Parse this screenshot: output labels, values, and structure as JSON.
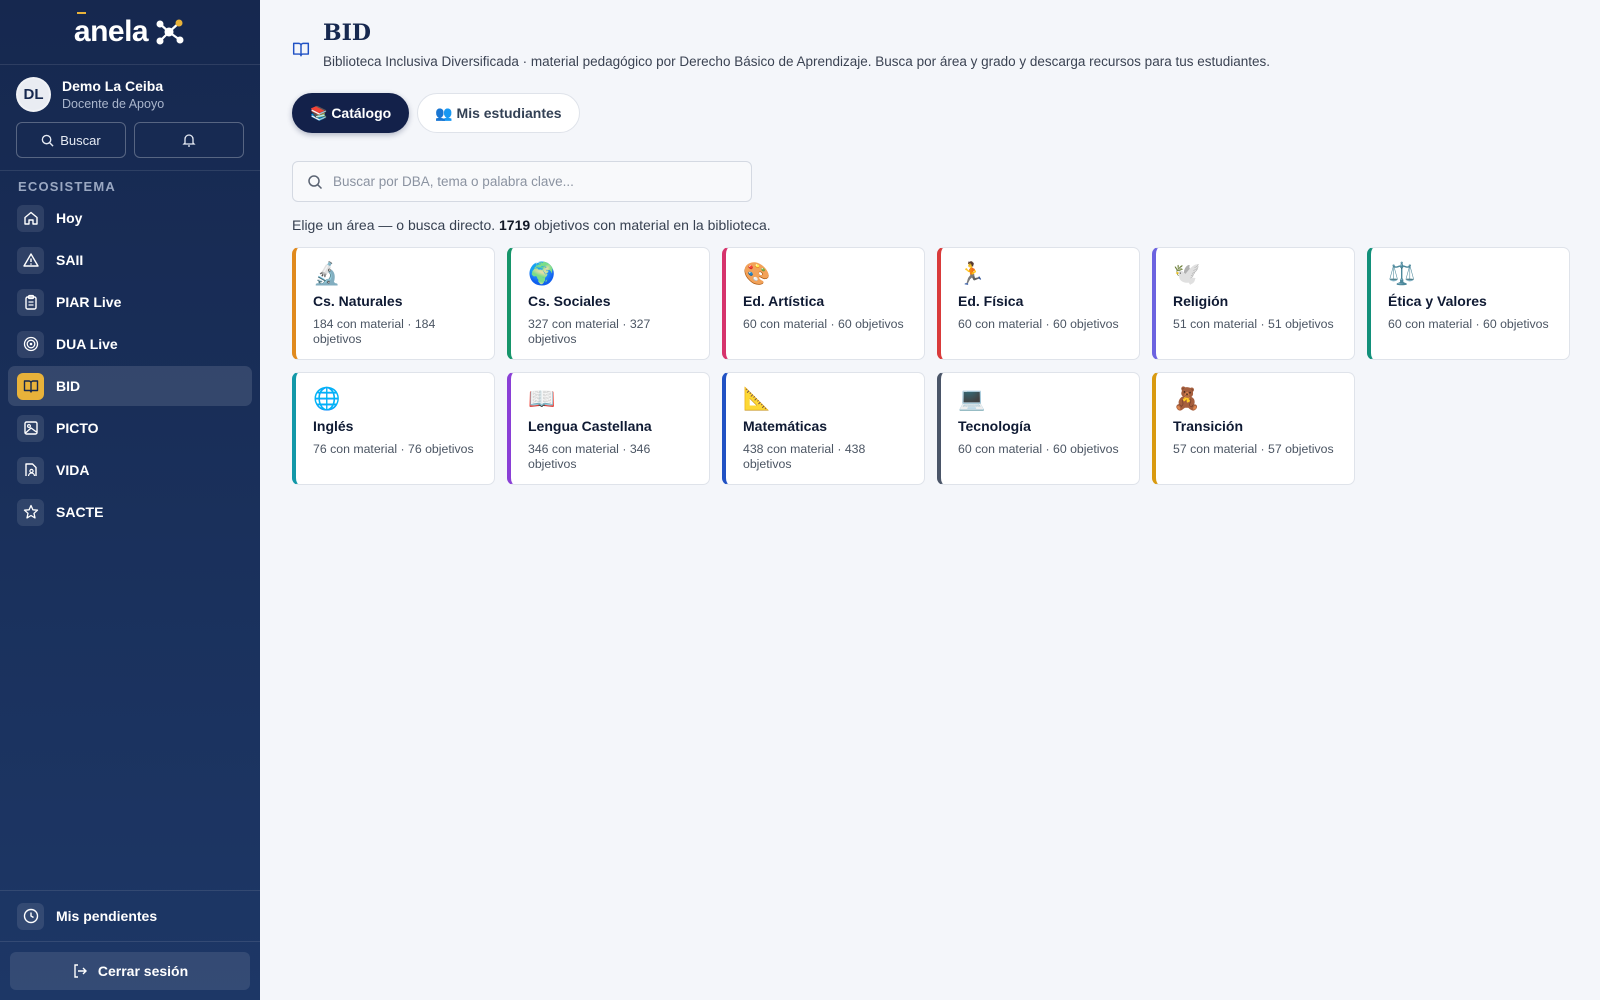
{
  "brand": {
    "name": "anela"
  },
  "user": {
    "initials": "DL",
    "name": "Demo La Ceiba",
    "role": "Docente de Apoyo"
  },
  "quick": {
    "search_label": "Buscar"
  },
  "sidebar": {
    "section_label": "ECOSISTEMA",
    "items": [
      {
        "label": "Hoy",
        "icon": "home-icon"
      },
      {
        "label": "SAII",
        "icon": "alert-triangle-icon"
      },
      {
        "label": "PIAR Live",
        "icon": "clipboard-icon"
      },
      {
        "label": "DUA Live",
        "icon": "target-icon"
      },
      {
        "label": "BID",
        "icon": "book-open-icon",
        "active": true
      },
      {
        "label": "PICTO",
        "icon": "image-icon"
      },
      {
        "label": "VIDA",
        "icon": "file-user-icon"
      },
      {
        "label": "SACTE",
        "icon": "star-icon"
      }
    ],
    "pending_label": "Mis pendientes",
    "logout_label": "Cerrar sesión"
  },
  "page": {
    "title": "BID",
    "subtitle": "Biblioteca Inclusiva Diversificada · material pedagógico por Derecho Básico de Aprendizaje. Busca por área y grado y descarga recursos para tus estudiantes."
  },
  "tabs": [
    {
      "label": "📚 Catálogo",
      "active": true
    },
    {
      "label": "👥 Mis estudiantes",
      "active": false
    }
  ],
  "search": {
    "placeholder": "Buscar por DBA, tema o palabra clave..."
  },
  "summary": {
    "before": "Elige un área — o busca directo.",
    "count": "1719",
    "after": "objetivos con material en la biblioteca."
  },
  "colors": {
    "sidebar": "#16284f",
    "accent": "#e8b23a",
    "active_tab": "#13214a"
  },
  "areas": [
    {
      "emoji": "🔬",
      "name": "Cs. Naturales",
      "meta": "184 con material · 184 objetivos",
      "color": "#e08a1e"
    },
    {
      "emoji": "🌍",
      "name": "Cs. Sociales",
      "meta": "327 con material · 327 objetivos",
      "color": "#16956a"
    },
    {
      "emoji": "🎨",
      "name": "Ed. Artística",
      "meta": "60 con material · 60 objetivos",
      "color": "#d6336c"
    },
    {
      "emoji": "🏃",
      "name": "Ed. Física",
      "meta": "60 con material · 60 objetivos",
      "color": "#d93a3a"
    },
    {
      "emoji": "🕊️",
      "name": "Religión",
      "meta": "51 con material · 51 objetivos",
      "color": "#6c63e0"
    },
    {
      "emoji": "⚖️",
      "name": "Ética y Valores",
      "meta": "60 con material · 60 objetivos",
      "color": "#12907a"
    },
    {
      "emoji": "🌐",
      "name": "Inglés",
      "meta": "76 con material · 76 objetivos",
      "color": "#1298a8"
    },
    {
      "emoji": "📖",
      "name": "Lengua Castellana",
      "meta": "346 con material · 346 objetivos",
      "color": "#8a3fd6"
    },
    {
      "emoji": "📐",
      "name": "Matemáticas",
      "meta": "438 con material · 438 objetivos",
      "color": "#2152c4"
    },
    {
      "emoji": "💻",
      "name": "Tecnología",
      "meta": "60 con material · 60 objetivos",
      "color": "#4a5568"
    },
    {
      "emoji": "🧸",
      "name": "Transición",
      "meta": "57 con material · 57 objetivos",
      "color": "#d99a10"
    }
  ]
}
